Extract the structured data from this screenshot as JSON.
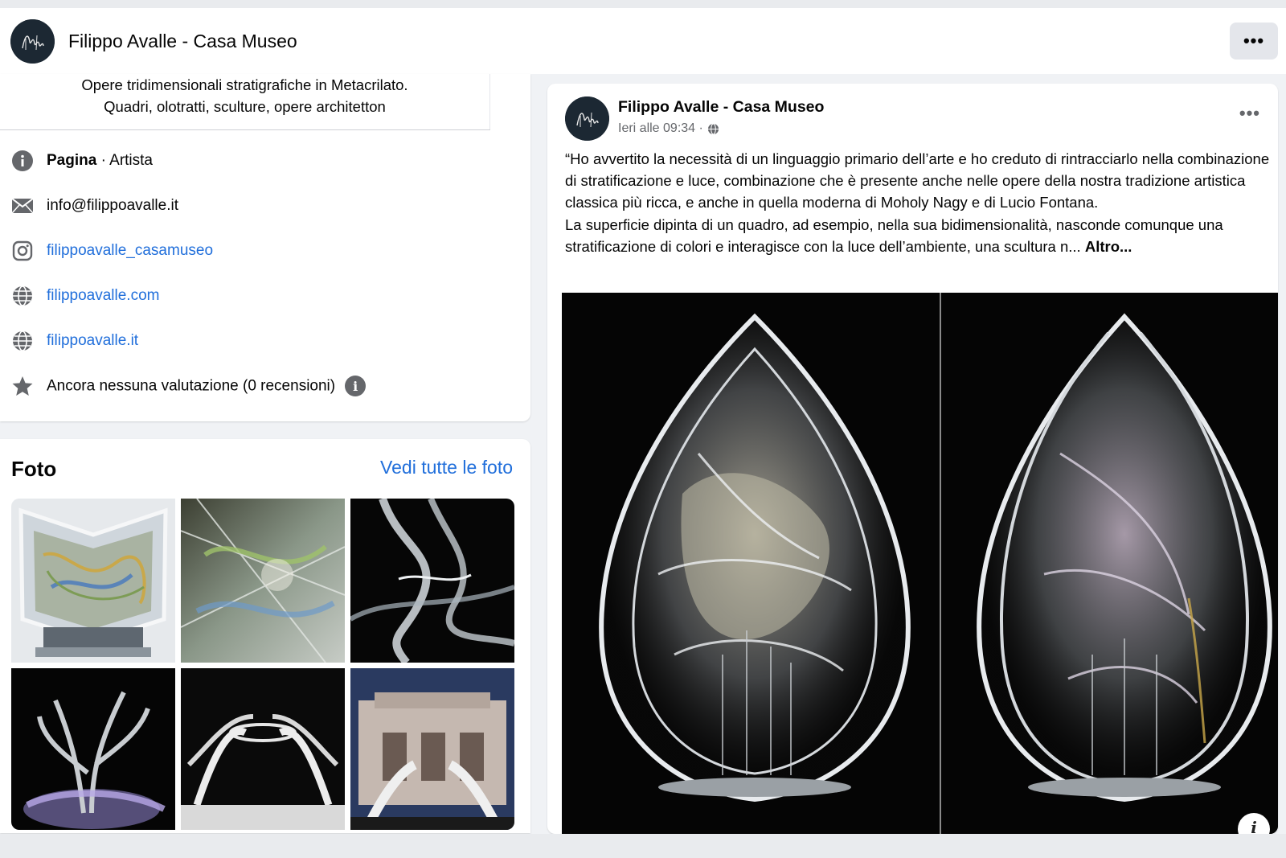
{
  "header": {
    "page_name": "Filippo Avalle - Casa Museo",
    "more_label": "•••"
  },
  "intro": {
    "bio_line1": "Opere tridimensionali stratigrafiche in Metacrilato.",
    "bio_line2": "Quadri, olotratti, sculture, opere architetton",
    "category_bold": "Pagina",
    "category_rest": " · Artista",
    "email": "info@filippoavalle.it",
    "instagram": "filippoavalle_casamuseo",
    "website1": "filippoavalle.com",
    "website2": "filippoavalle.it",
    "rating": "Ancora nessuna valutazione (0 recensioni)",
    "rating_info_icon": "i"
  },
  "photos": {
    "title": "Foto",
    "see_all": "Vedi tutte le foto"
  },
  "post": {
    "author": "Filippo Avalle - Casa Museo",
    "time": "Ieri alle 09:34 ·",
    "more_label": "•••",
    "paragraph1": "“Ho avvertito la necessità di un linguaggio primario dell’arte e ho creduto di rintracciarlo nella combinazione di stratificazione e luce, combinazione che è presente anche nelle opere della nostra tradizione artistica classica più ricca, e anche in quella moderna di Moholy Nagy e di Lucio Fontana.",
    "paragraph2": "La superficie dipinta di un quadro, ad esempio, nella sua bidimensionalità, nasconde comunque una stratificazione di colori e interagisce con la luce dell’ambiente, una scultura n...",
    "see_more": "Altro...",
    "image_info_icon": "i"
  },
  "icons": {
    "avatar": "page-logo-signature",
    "info": "info-circle-icon",
    "email": "envelope-icon",
    "instagram": "instagram-icon",
    "web": "globe-icon",
    "rating": "star-icon",
    "audience": "globe-icon"
  },
  "colors": {
    "link": "#216fdb",
    "icon_gray": "#65676b",
    "background": "#f0f2f5"
  }
}
